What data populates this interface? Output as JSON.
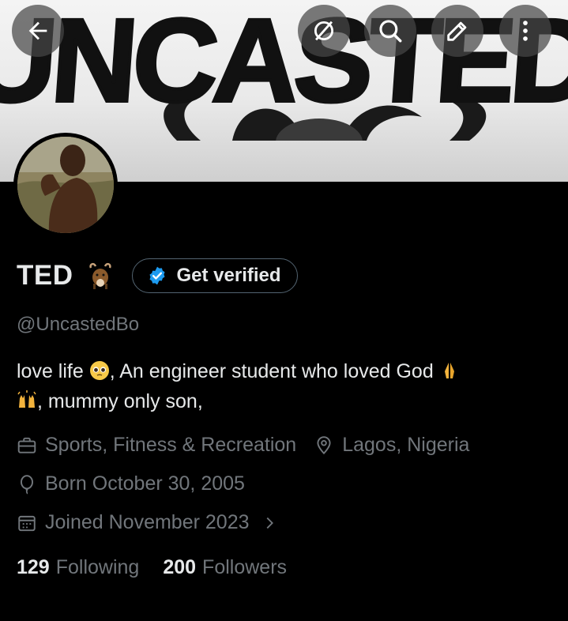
{
  "header": {
    "banner_text": "UNCASTED",
    "buttons": [
      "back",
      "explore",
      "search",
      "edit",
      "more"
    ]
  },
  "profile": {
    "name": "TED",
    "name_emoji": "goat",
    "verify_label": "Get verified",
    "handle": "@UncastedBo",
    "bio_line1_a": "love life",
    "bio_line1_b": ",  An engineer student who loved God",
    "bio_line2": ", mummy only son,",
    "category": "Sports, Fitness & Recreation",
    "location": "Lagos, Nigeria",
    "birthday": "Born October 30, 2005",
    "joined": "Joined November 2023"
  },
  "stats": {
    "following_count": "129",
    "following_label": "Following",
    "followers_count": "200",
    "followers_label": "Followers"
  },
  "colors": {
    "background": "#000000",
    "text": "#e7e9ea",
    "muted": "#71767b",
    "verified_blue": "#1d9bf0"
  }
}
